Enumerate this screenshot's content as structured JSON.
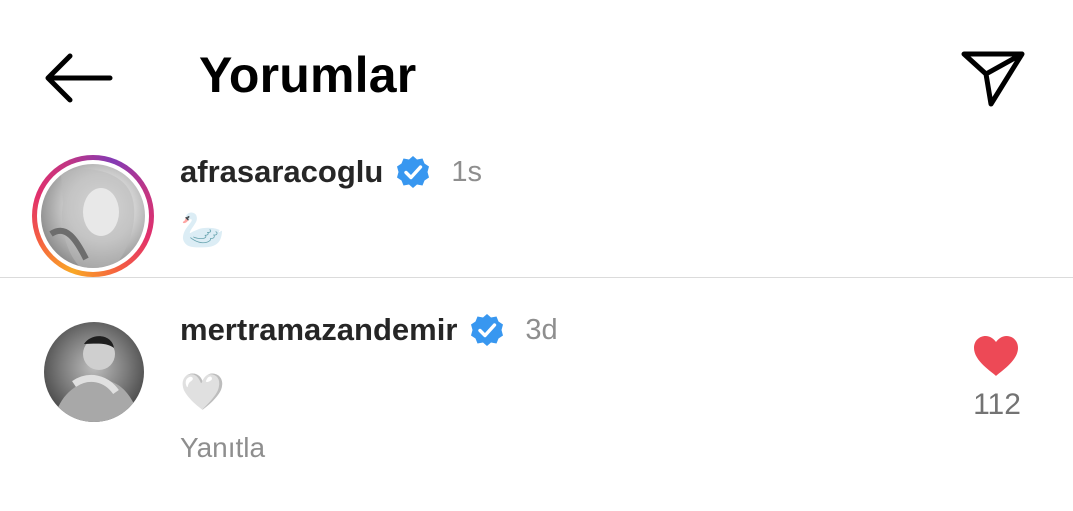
{
  "header": {
    "title": "Yorumlar",
    "back_icon": "arrow-left-icon",
    "send_icon": "paper-plane-icon"
  },
  "comments": [
    {
      "username": "afrasaracoglu",
      "verified": true,
      "timestamp": "1s",
      "text": "🦢",
      "avatar_story_ring": true
    },
    {
      "username": "mertramazandemir",
      "verified": true,
      "timestamp": "3d",
      "text": "🤍",
      "reply_label": "Yanıtla",
      "liked": true,
      "like_count": "112"
    }
  ],
  "colors": {
    "verified_badge": "#3897f0",
    "heart_liked": "#ed4956",
    "secondary_text": "#8e8e8e",
    "divider": "#dbdbdb"
  }
}
